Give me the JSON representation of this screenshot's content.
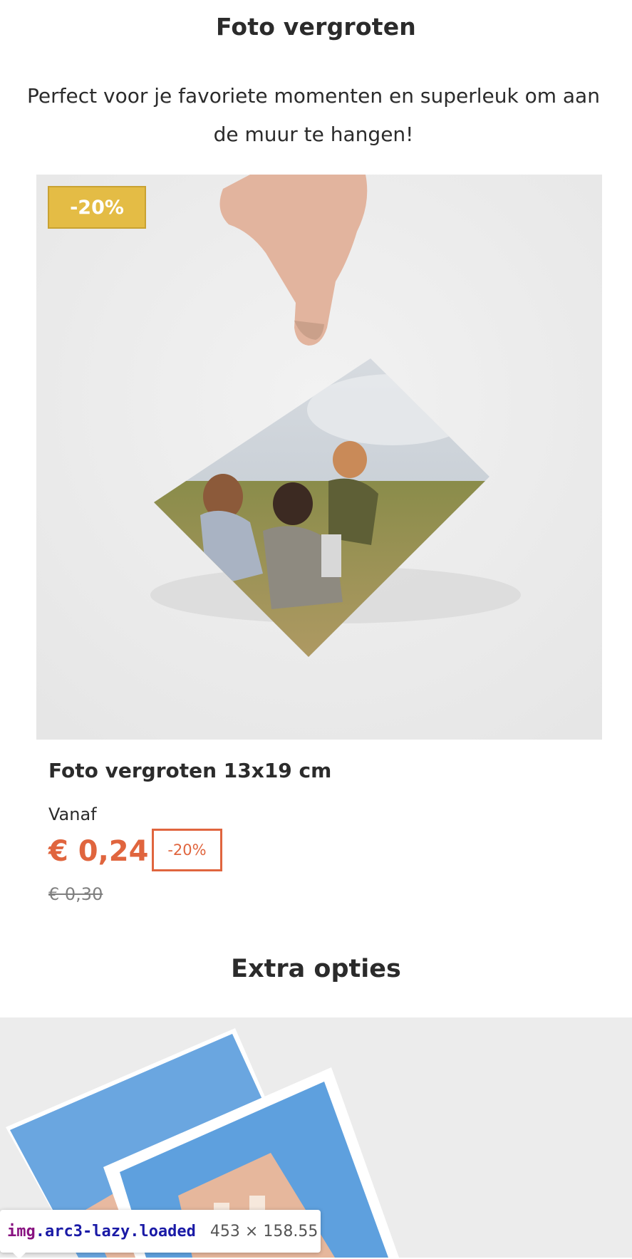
{
  "header": {
    "title": "Foto vergroten",
    "intro": "Perfect voor je favoriete momenten en superleuk om aan de muur te hangen!"
  },
  "product": {
    "badge": "-20%",
    "name": "Foto vergroten 13x19 cm",
    "price_from_label": "Vanaf",
    "price_current": "€ 0,24",
    "price_discount": "-20%",
    "price_old": "€ 0,30",
    "colors": {
      "badge": "#e4bc45",
      "price": "#e0653e"
    }
  },
  "extras": {
    "title": "Extra opties"
  },
  "inspector": {
    "tag": "img",
    "classes": ".arc3-lazy.loaded",
    "dimensions": "453 × 158.55"
  }
}
